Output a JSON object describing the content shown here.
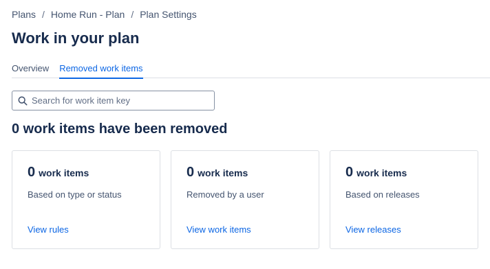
{
  "breadcrumb": {
    "items": [
      "Plans",
      "Home Run - Plan",
      "Plan Settings"
    ],
    "separator": "/"
  },
  "page": {
    "title": "Work in your plan"
  },
  "tabs": [
    {
      "label": "Overview",
      "active": false
    },
    {
      "label": "Removed work items",
      "active": true
    }
  ],
  "search": {
    "placeholder": "Search for work item key",
    "value": ""
  },
  "summary": {
    "heading": "0 work items have been removed"
  },
  "cards": [
    {
      "count": "0",
      "unit": "work items",
      "description": "Based on type or status",
      "link": "View rules"
    },
    {
      "count": "0",
      "unit": "work items",
      "description": "Removed by a user",
      "link": "View work items"
    },
    {
      "count": "0",
      "unit": "work items",
      "description": "Based on releases",
      "link": "View releases"
    }
  ],
  "colors": {
    "accent": "#0c66e4",
    "text": "#172b4d",
    "subtle_text": "#44546f",
    "border": "#dcdfe4"
  },
  "icons": {
    "search": "search-icon"
  }
}
